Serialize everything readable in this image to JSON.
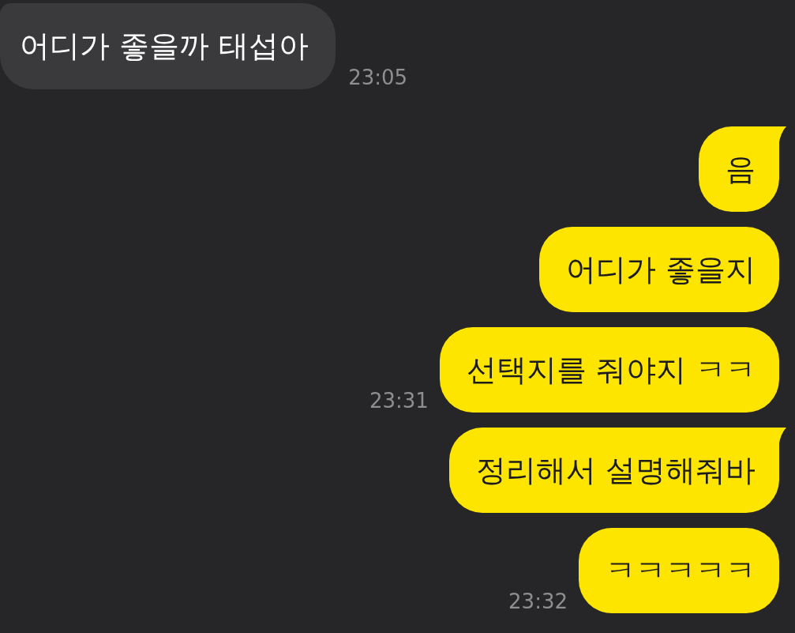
{
  "messages": [
    {
      "kind": "received",
      "text": "어디가 좋을까 태섭아",
      "time": "23:05",
      "tail": true
    },
    {
      "kind": "sent",
      "text": "음",
      "tail": true
    },
    {
      "kind": "sent",
      "text": "어디가 좋을지",
      "tail": false
    },
    {
      "kind": "sent",
      "text": "선택지를 줘야지 ㅋㅋ",
      "time": "23:31",
      "tail": false
    },
    {
      "kind": "sent",
      "text": "정리해서 설명해줘바",
      "tail": true
    },
    {
      "kind": "sent",
      "text": "ㅋㅋㅋㅋㅋ",
      "time": "23:32",
      "tail": false
    }
  ]
}
